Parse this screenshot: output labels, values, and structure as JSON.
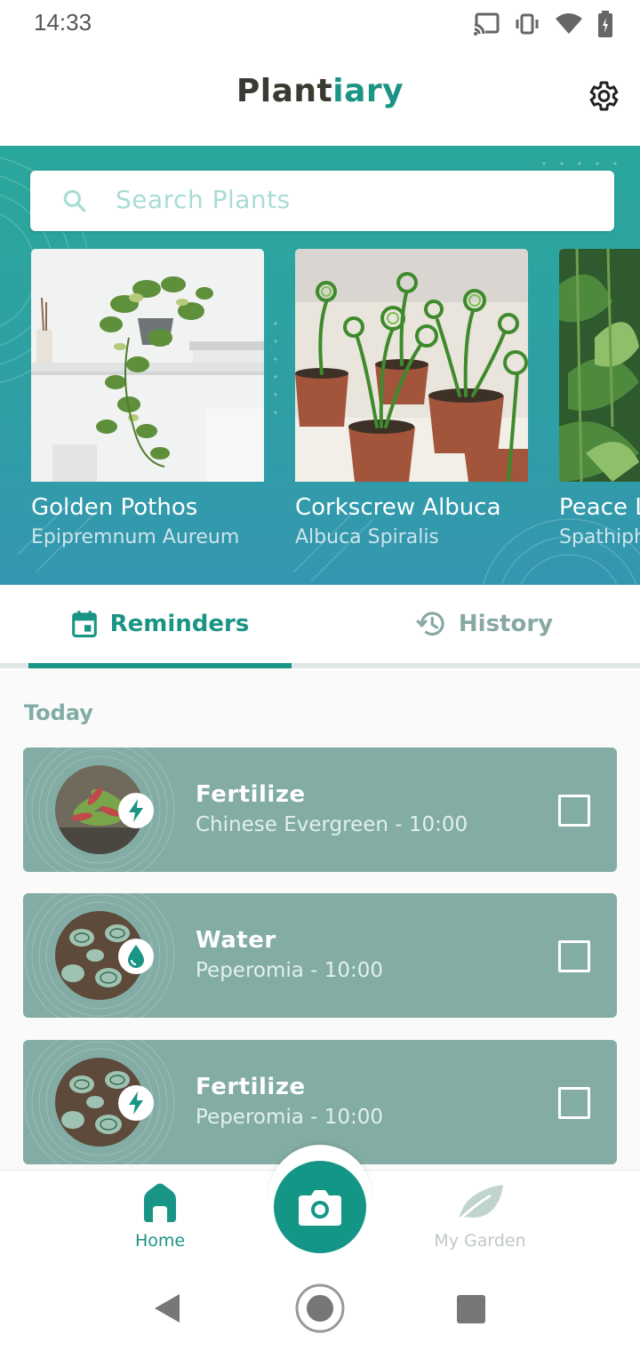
{
  "status_bar": {
    "time": "14:33"
  },
  "app": {
    "title_part1": "Plant",
    "title_part2": "iary"
  },
  "search": {
    "placeholder": "Search Plants"
  },
  "plants": [
    {
      "name": "Golden Pothos",
      "scientific": "Epipremnum Aureum"
    },
    {
      "name": "Corkscrew Albuca",
      "scientific": "Albuca Spiralis"
    },
    {
      "name": "Peace Lily",
      "scientific": "Spathiphyllum"
    }
  ],
  "tabs": [
    {
      "label": "Reminders",
      "active": true
    },
    {
      "label": "History",
      "active": false
    }
  ],
  "reminders": {
    "section_heading": "Today",
    "items": [
      {
        "action": "Fertilize",
        "detail": "Chinese Evergreen - 10:00",
        "badge_icon": "lightning-icon",
        "checked": false
      },
      {
        "action": "Water",
        "detail": "Peperomia - 10:00",
        "badge_icon": "water-drop-icon",
        "checked": false
      },
      {
        "action": "Fertilize",
        "detail": "Peperomia - 10:00",
        "badge_icon": "lightning-icon",
        "checked": false
      }
    ]
  },
  "bottom_nav": {
    "home_label": "Home",
    "garden_label": "My Garden"
  },
  "colors": {
    "accent": "#1a9485",
    "hero": "#2aa79b",
    "card": "#82aca4"
  }
}
